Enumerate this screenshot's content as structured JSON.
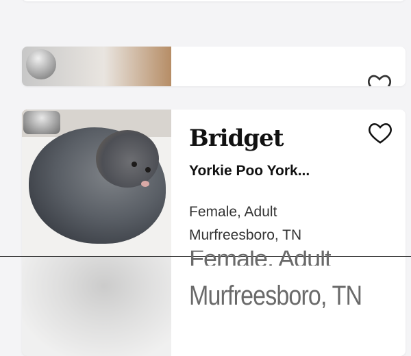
{
  "listings": [
    {
      "name": "",
      "partially_visible": true
    },
    {
      "name": "",
      "partially_visible": true
    },
    {
      "name": "Bridget",
      "breed": "Yorkie Poo York...",
      "sex_age": "Female, Adult",
      "location": "Murfreesboro, TN",
      "favorite_icon": "heart-outline-icon"
    }
  ],
  "zoom_overlay": {
    "sex_age": "Female, Adult",
    "location": "Murfreesboro, TN"
  },
  "colors": {
    "background": "#f4f4f6",
    "card": "#ffffff",
    "text": "#111111"
  }
}
